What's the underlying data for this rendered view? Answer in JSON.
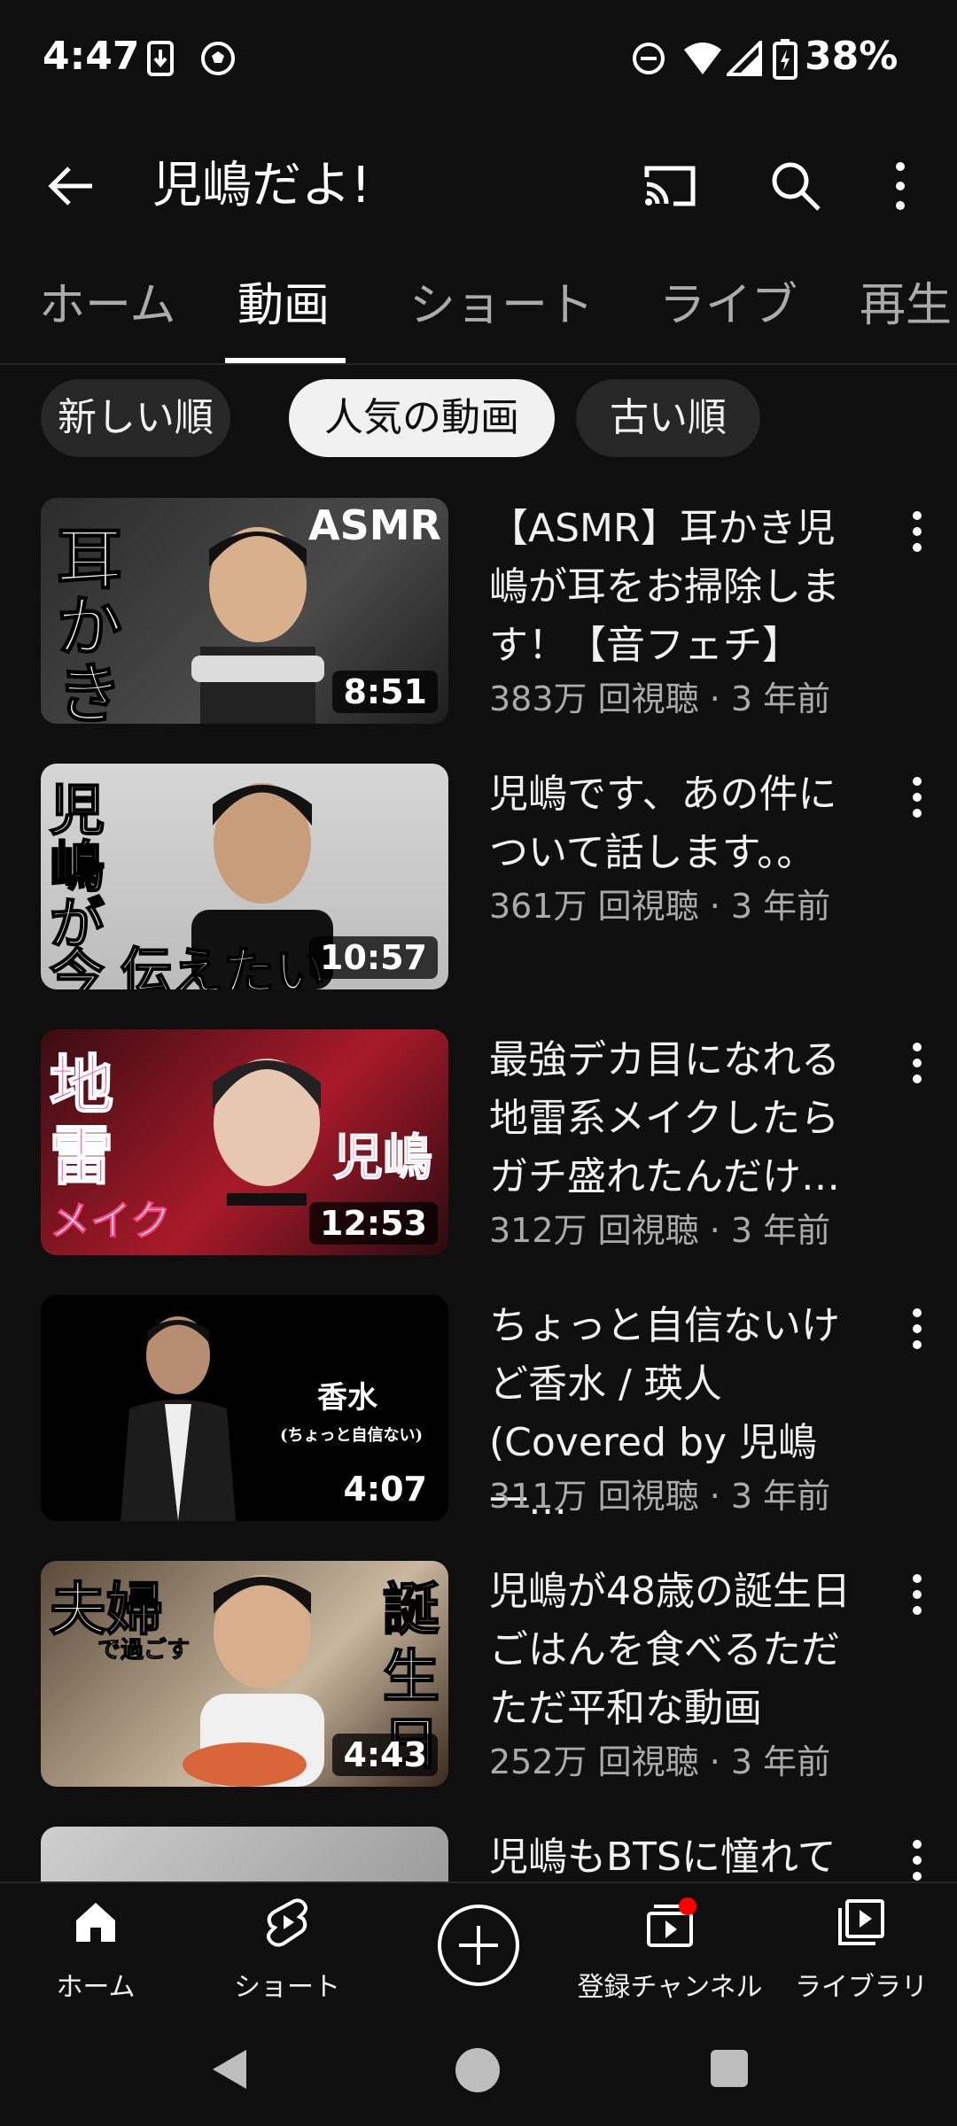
{
  "status_bar": {
    "time": "4:47",
    "battery": "38%"
  },
  "app_bar": {
    "title": "児嶋だよ!"
  },
  "tabs": [
    {
      "label": "ホーム"
    },
    {
      "label": "動画"
    },
    {
      "label": "ショート"
    },
    {
      "label": "ライブ"
    },
    {
      "label": "再生"
    }
  ],
  "chips": [
    {
      "label": "新しい順"
    },
    {
      "label": "人気の動画"
    },
    {
      "label": "古い順"
    }
  ],
  "videos": [
    {
      "title": "【ASMR】耳かき児嶋が耳をお掃除します！【音フェチ】",
      "meta": "383万 回視聴 · 3 年前",
      "duration": "8:51",
      "thumb_text": [
        "耳",
        "か",
        "き",
        "ASMR"
      ]
    },
    {
      "title": "児嶋です、あの件について話します。。",
      "meta": "361万 回視聴 · 3 年前",
      "duration": "10:57",
      "thumb_text": [
        "児",
        "嶋",
        "が",
        "今",
        "伝えたい"
      ]
    },
    {
      "title": "最強デカ目になれる地雷系メイクしたらガチ盛れたんだけ…",
      "meta": "312万 回視聴 · 3 年前",
      "duration": "12:53",
      "thumb_text": [
        "地",
        "雷",
        "メイク",
        "児嶋"
      ]
    },
    {
      "title": "ちょっと自信ないけど香水 / 瑛人 (Covered by 児嶋一…",
      "meta": "311万 回視聴 · 3 年前",
      "duration": "4:07",
      "thumb_text": [
        "香水",
        "(ちょっと自信ない)"
      ]
    },
    {
      "title": "児嶋が48歳の誕生日ごはんを食べるただただ平和な動画",
      "meta": "252万 回視聴 · 3 年前",
      "duration": "4:43",
      "thumb_text": [
        "夫婦",
        "で過ごす",
        "誕",
        "生",
        "日"
      ]
    },
    {
      "title": "児嶋もBTSに憧れて",
      "meta": "",
      "duration": "",
      "thumb_text": []
    }
  ],
  "bottom_nav": [
    {
      "label": "ホーム",
      "icon": "home-icon"
    },
    {
      "label": "ショート",
      "icon": "shorts-icon"
    },
    {
      "label": "",
      "icon": "create-plus-icon"
    },
    {
      "label": "登録チャンネル",
      "icon": "subscriptions-icon"
    },
    {
      "label": "ライブラリ",
      "icon": "library-icon"
    }
  ],
  "colors": {
    "background": "#0f0f0f",
    "chip_bg": "#272727",
    "chip_active_bg": "#f1f1f1",
    "secondary_text": "#aaaaaa",
    "notification_dot": "#ff0000"
  }
}
